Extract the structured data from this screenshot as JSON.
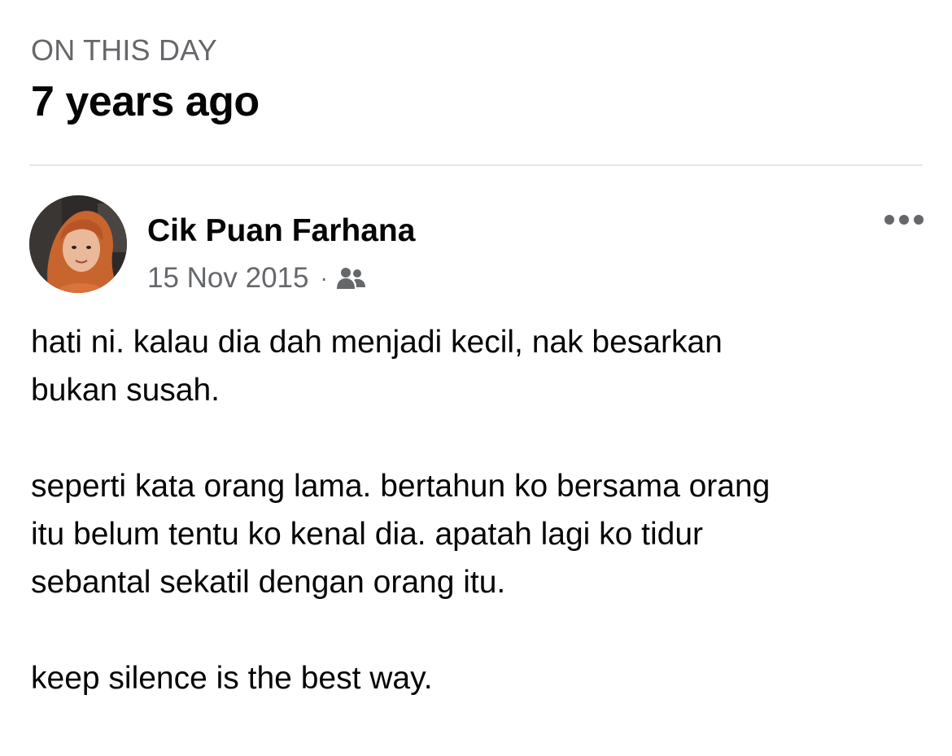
{
  "memory_header": {
    "label": "ON THIS DAY",
    "title": "7 years ago"
  },
  "post": {
    "author_name": "Cik Puan Farhana",
    "date": "15 Nov 2015",
    "separator": "·",
    "audience_icon": "friends-icon",
    "more_icon": "more-horizontal-icon",
    "paragraphs": [
      "hati ni. kalau dia dah menjadi kecil, nak besarkan\nbukan susah.",
      "seperti kata orang lama. bertahun ko bersama orang\nitu belum tentu ko kenal dia. apatah lagi ko tidur\nsebantal sekatil dengan orang itu.",
      "keep silence is the best way."
    ]
  },
  "colors": {
    "text_primary": "#050505",
    "text_secondary": "#65676b",
    "divider": "#e4e6eb",
    "hijab": "#c8642e"
  }
}
